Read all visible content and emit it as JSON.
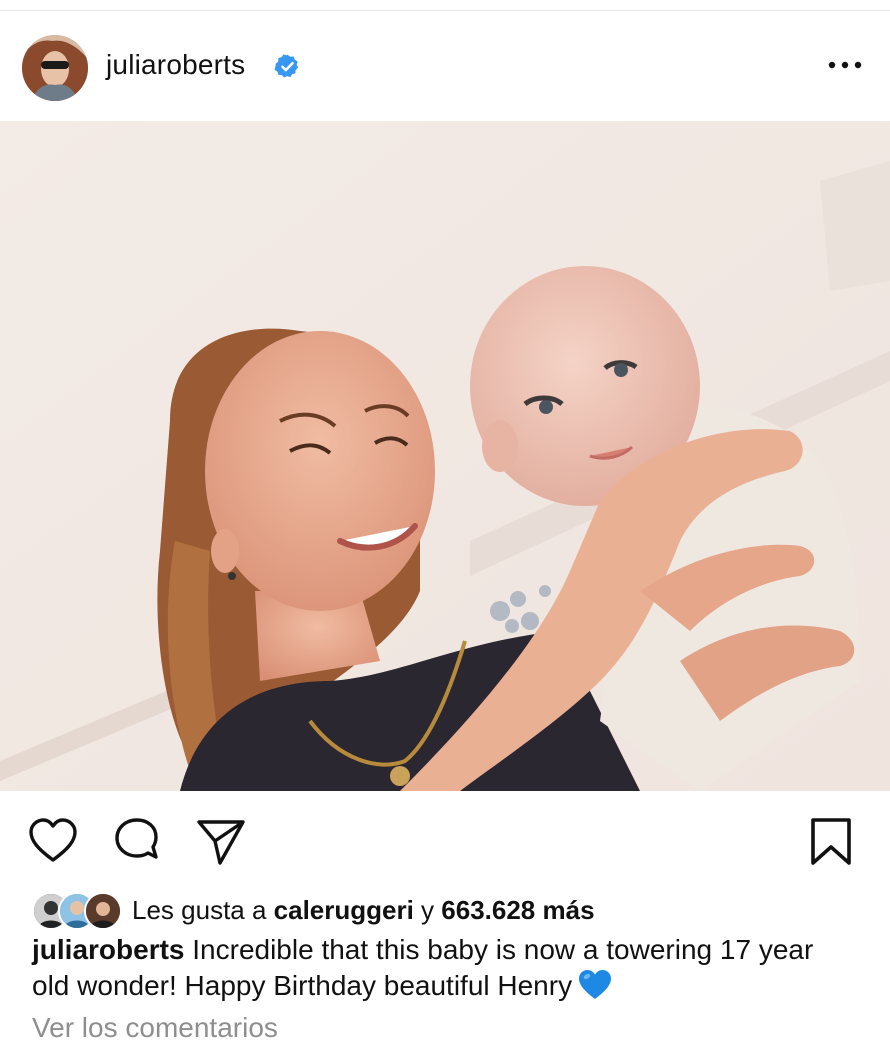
{
  "post": {
    "username": "juliaroberts",
    "verified": true,
    "more_icon": "more-horizontal-icon",
    "photo_description_icon": "post-photo"
  },
  "actions": {
    "like_icon": "heart-outline-icon",
    "comment_icon": "comment-bubble-icon",
    "share_icon": "paper-plane-icon",
    "save_icon": "bookmark-icon"
  },
  "likes": {
    "prefix": "Les gusta a ",
    "user": "caleruggeri",
    "connector": " y ",
    "count": "663.628 más"
  },
  "caption": {
    "user": "juliaroberts",
    "text": " Incredible that this baby is now a towering 17 year old wonder! Happy Birthday beautiful Henry",
    "emoji": "blue-heart-emoji"
  },
  "comments": {
    "label": "Ver los comentarios"
  },
  "colors": {
    "verified_blue": "#3897f0",
    "heart_blue": "#1e88e5",
    "text": "#111111",
    "muted": "#8e8e8e"
  }
}
